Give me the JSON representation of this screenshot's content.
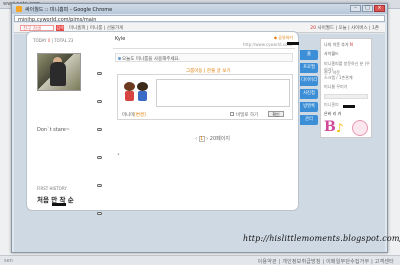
{
  "background": {
    "url": "www.nate.com",
    "fragment": "sen"
  },
  "window": {
    "title": "싸이월드 :: 미니홈피 - Google Chrome",
    "address": "minihp.cyworld.com/pims/main",
    "controls": {
      "minimize": "–",
      "maximize": "□",
      "close": "×"
    }
  },
  "cy_top": {
    "search_placeholder": "친구 검색",
    "search_button": "검색",
    "nav_links": "미니홈피 | 미니룸 | 선물가게",
    "right_links": "사이월드 | 오늘 | 사이버스 | 1촌",
    "right_highlight": "20"
  },
  "minihompy": {
    "left": {
      "today_label": "TODAY",
      "today_value": "0",
      "total_label": "TOTAL",
      "total_value": "23",
      "status": "Don`t stare~",
      "history_label": "FIRST HISTORY",
      "signature": "처음 만 작 순"
    },
    "right": {
      "name": "Kyle",
      "url": "http://www.cyworld.com/",
      "share_label": "◆ 공유하기",
      "notice": "오늘도 미니룸을 사용해주세요.",
      "move_link": "그룹이동 | 한줄 글 보기",
      "minime_label": "미니미",
      "change_label": "[변경]",
      "secret_label": "비밀로 하기",
      "confirm": "확인",
      "pager_prev": "‹",
      "pager_current": "1",
      "pager_next": "› 20페이지",
      "bullet": "•"
    },
    "tabs": [
      "홈",
      "프로필",
      "다이어리",
      "사진첩",
      "방명록",
      "관리"
    ]
  },
  "side_panel": {
    "line1": "나의 이웃 추가",
    "line1_highlight": "N",
    "line2": "사이월드",
    "line3": "미니홈피를 방문하신 분 (우리가)",
    "line4_a": "친구 이웃",
    "line4_b": "스크랩 / 1촌관계",
    "line5": "미니룸 꾸미기",
    "line7": "미니홈피",
    "line8": "은비 리 카",
    "sticker_letter": "B",
    "sticker_mark": "♪"
  },
  "blog_watermark": "http://hislittlemoments.blogspot.com/",
  "bottom_bar": {
    "links": "이용약관 | 개인정보취급방침 | 이메일무단수집거부 | 고객센터"
  }
}
